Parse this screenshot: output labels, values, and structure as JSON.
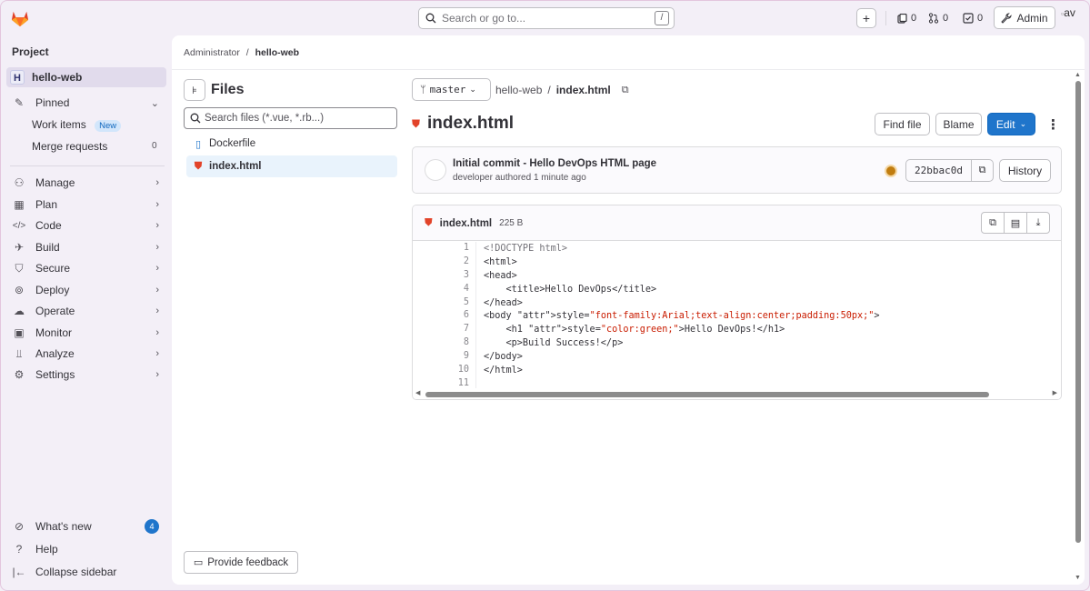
{
  "topbar": {
    "search_placeholder": "Search or go to...",
    "search_shortcut": "/",
    "issues_count": "0",
    "merge_requests_count": "0",
    "todos_count": "0",
    "admin_label": "Admin",
    "avatar_alt": "av"
  },
  "sidebar": {
    "section_title": "Project",
    "project_initial": "H",
    "project_name": "hello-web",
    "pinned_label": "Pinned",
    "work_items_label": "Work items",
    "work_items_badge": "New",
    "merge_requests_label": "Merge requests",
    "merge_requests_count": "0",
    "items": [
      {
        "label": "Manage",
        "icon": "users-icon"
      },
      {
        "label": "Plan",
        "icon": "calendar-icon"
      },
      {
        "label": "Code",
        "icon": "code-icon"
      },
      {
        "label": "Build",
        "icon": "rocket-icon"
      },
      {
        "label": "Secure",
        "icon": "shield-icon"
      },
      {
        "label": "Deploy",
        "icon": "deploy-icon"
      },
      {
        "label": "Operate",
        "icon": "cloud-icon"
      },
      {
        "label": "Monitor",
        "icon": "monitor-icon"
      },
      {
        "label": "Analyze",
        "icon": "chart-icon"
      },
      {
        "label": "Settings",
        "icon": "gear-icon"
      }
    ],
    "whats_new_label": "What's new",
    "whats_new_count": "4",
    "help_label": "Help",
    "collapse_label": "Collapse sidebar"
  },
  "breadcrumb": {
    "parent": "Administrator",
    "separator": "/",
    "current": "hello-web"
  },
  "file_tree": {
    "title": "Files",
    "search_placeholder": "Search files (*.vue, *.rb...)",
    "files": [
      {
        "name": "Dockerfile",
        "active": false
      },
      {
        "name": "index.html",
        "active": true
      }
    ],
    "feedback_label": "Provide feedback"
  },
  "blob_view": {
    "branch": "master",
    "path_root": "hello-web",
    "path_sep": "/",
    "path_file": "index.html",
    "file_title": "index.html",
    "find_file_label": "Find file",
    "blame_label": "Blame",
    "edit_label": "Edit",
    "commit": {
      "message": "Initial commit - Hello DevOps HTML page",
      "meta": "developer authored 1 minute ago",
      "sha": "22bbac0d",
      "history_label": "History"
    },
    "file_header_name": "index.html",
    "file_size": "225 B",
    "code_lines": [
      {
        "n": "1",
        "text": "<!DOCTYPE html>"
      },
      {
        "n": "2",
        "text": "<html>"
      },
      {
        "n": "3",
        "text": "<head>"
      },
      {
        "n": "4",
        "text": "    <title>Hello DevOps</title>"
      },
      {
        "n": "5",
        "text": "</head>"
      },
      {
        "n": "6",
        "text": "<body style=\"font-family:Arial;text-align:center;padding:50px;\">"
      },
      {
        "n": "7",
        "text": "    <h1 style=\"color:green;\">Hello DevOps!</h1>"
      },
      {
        "n": "8",
        "text": "    <p>Build Success!</p>"
      },
      {
        "n": "9",
        "text": "</body>"
      },
      {
        "n": "10",
        "text": "</html>"
      },
      {
        "n": "11",
        "text": ""
      }
    ]
  },
  "colors": {
    "accent": "#1f75cb",
    "sidebar_bg": "#f3eff7",
    "html_file_icon": "#e24329",
    "pipeline_running": "#c17d10"
  }
}
